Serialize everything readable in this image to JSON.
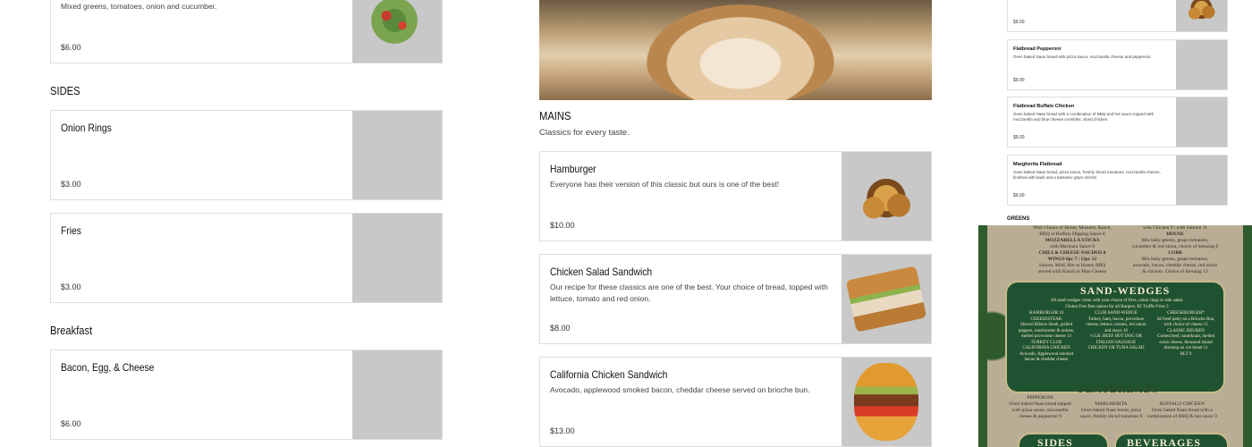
{
  "left": {
    "top_item": {
      "desc": "Mixed greens, tomatoes, onion and cucumber.",
      "price": "$6.00"
    },
    "sides_title": "SIDES",
    "sides": [
      {
        "name": "Onion Rings",
        "price": "$3.00"
      },
      {
        "name": "Fries",
        "price": "$3.00"
      }
    ],
    "breakfast_title": "Breakfast",
    "breakfast": [
      {
        "name": "Bacon, Egg, & Cheese",
        "price": "$6.00"
      }
    ]
  },
  "middle": {
    "mains_title": "MAINS",
    "mains_subtitle": "Classics for every taste.",
    "items": [
      {
        "name": "Hamburger",
        "desc": "Everyone has their version of this classic but ours is one of the best!",
        "price": "$10.00"
      },
      {
        "name": "Chicken Salad Sandwich",
        "desc": "Our recipe for these classics are one of the best. Your choice of bread, topped with lettuce, tomato and red onion.",
        "price": "$8.00"
      },
      {
        "name": "California Chicken Sandwich",
        "desc": "Avocado, applewood smoked bacon, cheddar cheese served on brioche bun.",
        "price": "$13.00"
      }
    ]
  },
  "right": {
    "items": [
      {
        "name": "",
        "desc": "",
        "price": "$9.00"
      },
      {
        "name": "Flatbread Pepperoni",
        "desc": "Oven baked Naan bread with pizza sauce, mozzarella cheese and pepperoni.",
        "price": "$9.00"
      },
      {
        "name": "Flatbread Buffalo Chicken",
        "desc": "Oven baked Naan bread with a combination of BBQ and hot sauce topped with mozzarella and blue cheese crumbles. diced chicken.",
        "price": "$9.00"
      },
      {
        "name": "Margherita Flatbread",
        "desc": "Oven baked Naan bread, pizza sauce, freshly sliced tomatoes, mozzarella cheese, finished with basil and a balsamic glaze drizzle.",
        "price": "$9.00"
      }
    ],
    "greens_title": "GREENS",
    "menu_board": {
      "sandwedges": "SAND-WEDGES",
      "flatbreads": "FLATBREADS",
      "sides": "SIDES",
      "beverages": "BEVERAGES",
      "lines_left": [
        "With Choice of Honey Mustard, Ranch,",
        "BBQ or Buffalo Dipping Sauce 8",
        "MOZZARELLA STICKS",
        "with Marinara Sauce 8",
        "CHILI & CHEESE NACHOS 8",
        "WINGS 6pc 7 | 12pc 12",
        "Sauces: Mild, Hot or Honey BBQ",
        "served with Ranch or Blue Cheese"
      ],
      "lines_right": [
        "with Chicken 9 | with Salmon 11",
        "HOUSE",
        "Mix baby greens, grape tomatoes,",
        "cucumber & red onion, choice of dressing 6",
        "COBB",
        "Mix baby greens, grape tomatoes,",
        "avocado, bacon, cheddar cheese, red onion",
        "& chicken. Choice of dressing 12"
      ]
    }
  }
}
